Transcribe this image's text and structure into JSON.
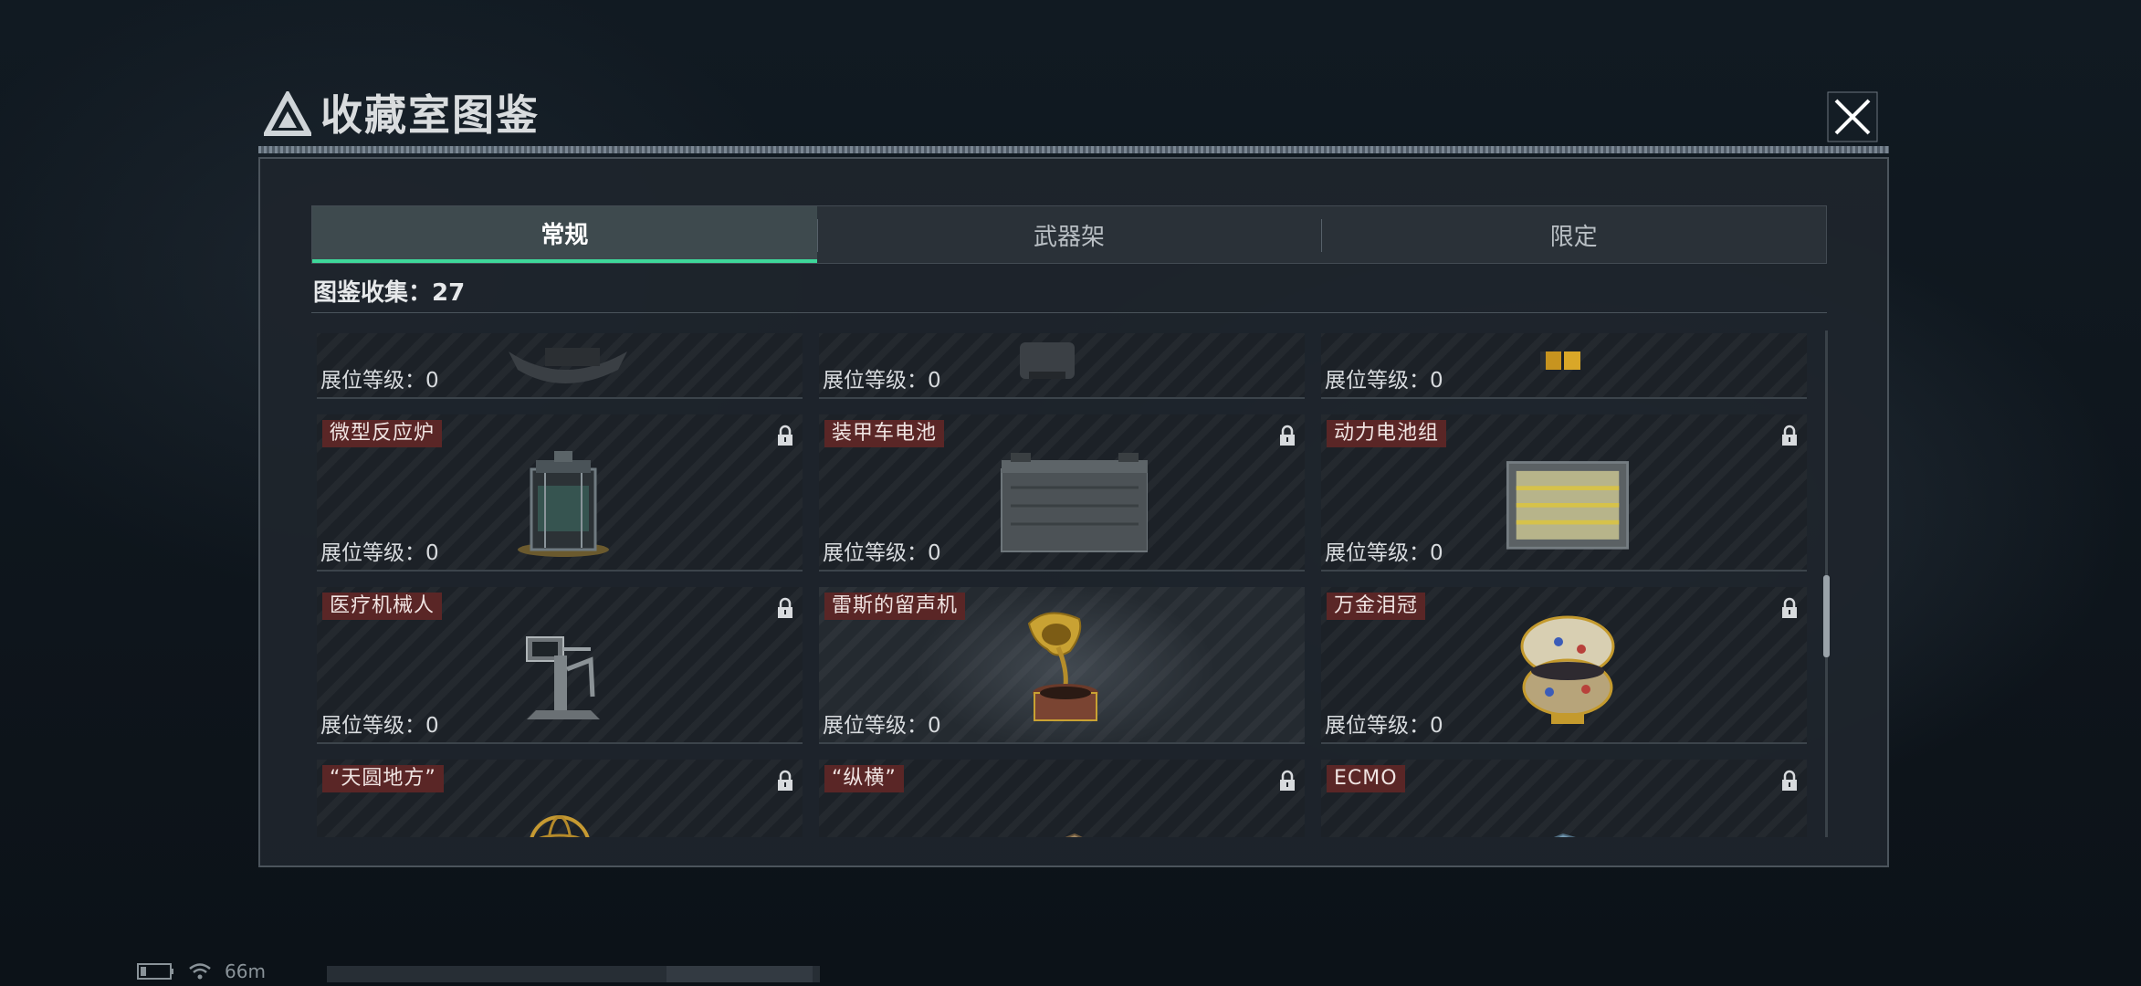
{
  "dialog": {
    "title": "收藏室图鉴",
    "close_label": "close"
  },
  "tabs": [
    {
      "label": "常规",
      "active": true
    },
    {
      "label": "武器架",
      "active": false
    },
    {
      "label": "限定",
      "active": false
    }
  ],
  "collection": {
    "label": "图鉴收集：27"
  },
  "level_label": "展位等级：0",
  "items": [
    {
      "name": "",
      "level": "展位等级：0",
      "locked": false,
      "icon": "item-partial-1"
    },
    {
      "name": "",
      "level": "展位等级：0",
      "locked": false,
      "icon": "item-partial-2"
    },
    {
      "name": "",
      "level": "展位等级：0",
      "locked": false,
      "icon": "item-partial-3"
    },
    {
      "name": "微型反应炉",
      "level": "展位等级：0",
      "locked": true,
      "icon": "reactor-icon"
    },
    {
      "name": "装甲车电池",
      "level": "展位等级：0",
      "locked": true,
      "icon": "battery-icon"
    },
    {
      "name": "动力电池组",
      "level": "展位等级：0",
      "locked": true,
      "icon": "battery-pack-icon"
    },
    {
      "name": "医疗机械人",
      "level": "展位等级：0",
      "locked": true,
      "icon": "medical-robot-icon"
    },
    {
      "name": "雷斯的留声机",
      "level": "展位等级：0",
      "locked": false,
      "icon": "gramophone-icon"
    },
    {
      "name": "万金泪冠",
      "level": "展位等级：0",
      "locked": true,
      "icon": "jeweled-egg-icon"
    },
    {
      "name": "“天圆地方”",
      "level": "",
      "locked": true,
      "icon": "armillary-sphere-icon"
    },
    {
      "name": "“纵横”",
      "level": "",
      "locked": true,
      "icon": "chessboard-icon"
    },
    {
      "name": "ECMO",
      "level": "",
      "locked": true,
      "icon": "ecmo-machine-icon"
    }
  ],
  "status": {
    "signal": "66m"
  },
  "colors": {
    "accent": "#3ed79a",
    "name_badge": "#5a2626"
  }
}
